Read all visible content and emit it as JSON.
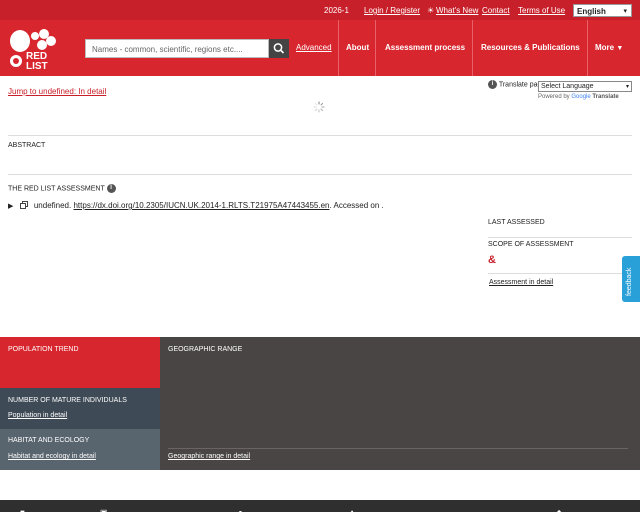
{
  "topbar": {
    "version": "2026-1",
    "login": "Login / Register",
    "whats_new": "What's New",
    "contact": "Contact",
    "terms": "Terms of Use",
    "language": "English"
  },
  "header": {
    "logo_text": "RED LIST",
    "search_placeholder": "Names - common, scientific, regions etc....",
    "advanced": "Advanced",
    "nav": [
      "About",
      "Assessment process",
      "Resources & Publications",
      "More"
    ]
  },
  "content": {
    "jump_link": "Jump to undefined: In detail",
    "translate_label": "Translate page",
    "select_language": "Select Language",
    "powered_by": "Powered by",
    "google_word": "Google",
    "translate_word": "Translate",
    "abstract": "ABSTRACT",
    "red_list_assessment": "THE RED LIST ASSESSMENT",
    "citation_prefix": "undefined.",
    "citation_doi": "https://dx.doi.org/10.2305/IUCN.UK.2014-1.RLTS.T21975A47443455.en",
    "citation_suffix": ". Accessed on .",
    "last_assessed": "LAST ASSESSED",
    "scope": "SCOPE OF ASSESSMENT",
    "scope_value": "&",
    "assessment_link": "Assessment in detail"
  },
  "feedback": "feedback",
  "panels": {
    "population_trend": "POPULATION TREND",
    "mature": "NUMBER OF MATURE INDIVIDUALS",
    "population_link": "Population in detail",
    "habitat": "HABITAT AND ECOLOGY",
    "habitat_link": "Habitat and ecology in detail",
    "geographic": "GEOGRAPHIC RANGE",
    "geographic_link": "Geographic range in detail"
  },
  "colors": {
    "brand_red": "#d8262f",
    "topbar_red": "#c8202a",
    "dark_panel": "#4a4545",
    "feedback_blue": "#2aa0d8"
  }
}
